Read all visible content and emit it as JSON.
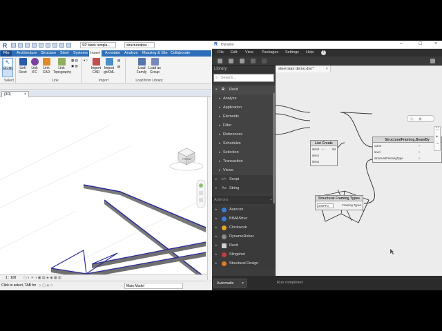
{
  "revit": {
    "logo": "R",
    "file_name": "SP blank templa...",
    "search_text": "structuredpar...",
    "tabs": [
      "File",
      "Architecture",
      "Structure",
      "Steel",
      "Systems",
      "Insert",
      "Annotate",
      "Analyze",
      "Massing & Site",
      "Collaborate"
    ],
    "active_tab": "Insert",
    "ribbon": {
      "modify_label": "Modify",
      "link_revit": "Link Revit",
      "link_ifc": "Link IFC",
      "link_cad": "Link CAD",
      "link_topography": "Link Topography",
      "import_cad": "Import CAD",
      "import_gbxml": "Import gbXML",
      "load_family": "Load Family",
      "load_as_group": "Load as Group",
      "group_select": "Select",
      "group_link": "Link",
      "group_import": "Import",
      "group_load": "Load from Library"
    },
    "view_tab": "{3D}",
    "view_scale": "1 : 100",
    "status_text": "Click to select, TAB for",
    "model_selector": "Main Model",
    "cube_label": "FRONT"
  },
  "dynamo": {
    "logo": "R",
    "title": "Dynamo",
    "menu": [
      "File",
      "Edit",
      "View",
      "Packages",
      "Settings",
      "Help"
    ],
    "library_title": "Library",
    "search_placeholder": "Search...",
    "library": {
      "revit": "Revit",
      "categories": [
        "Analyze",
        "Application",
        "Elements",
        "Filter",
        "References",
        "Schedules",
        "Selection",
        "Transaction",
        "Views"
      ],
      "other": [
        "Script",
        "String"
      ],
      "addons_title": "Add-ons",
      "addons": [
        "Aurecon",
        "BIMAStruc",
        "Clockwork",
        "DynamoRebar",
        "Revit",
        "Slingshot",
        "Structural Design"
      ]
    },
    "file_tab": "steel stair demo.dyn*",
    "nodes": {
      "list_create": {
        "title": "List Create",
        "inputs": [
          "item0",
          "item1",
          "item2"
        ],
        "output": "list"
      },
      "beam_by_curve": {
        "title": "StructuralFraming.BeamBy",
        "inputs": [
          "curve",
          "level",
          "structuralFramingType"
        ]
      },
      "framing_types": {
        "title": "Structural Framing Types",
        "value": "200PFC",
        "output": "Framing Types"
      }
    },
    "run_mode": "Automatic",
    "run_status": "Run completed."
  }
}
